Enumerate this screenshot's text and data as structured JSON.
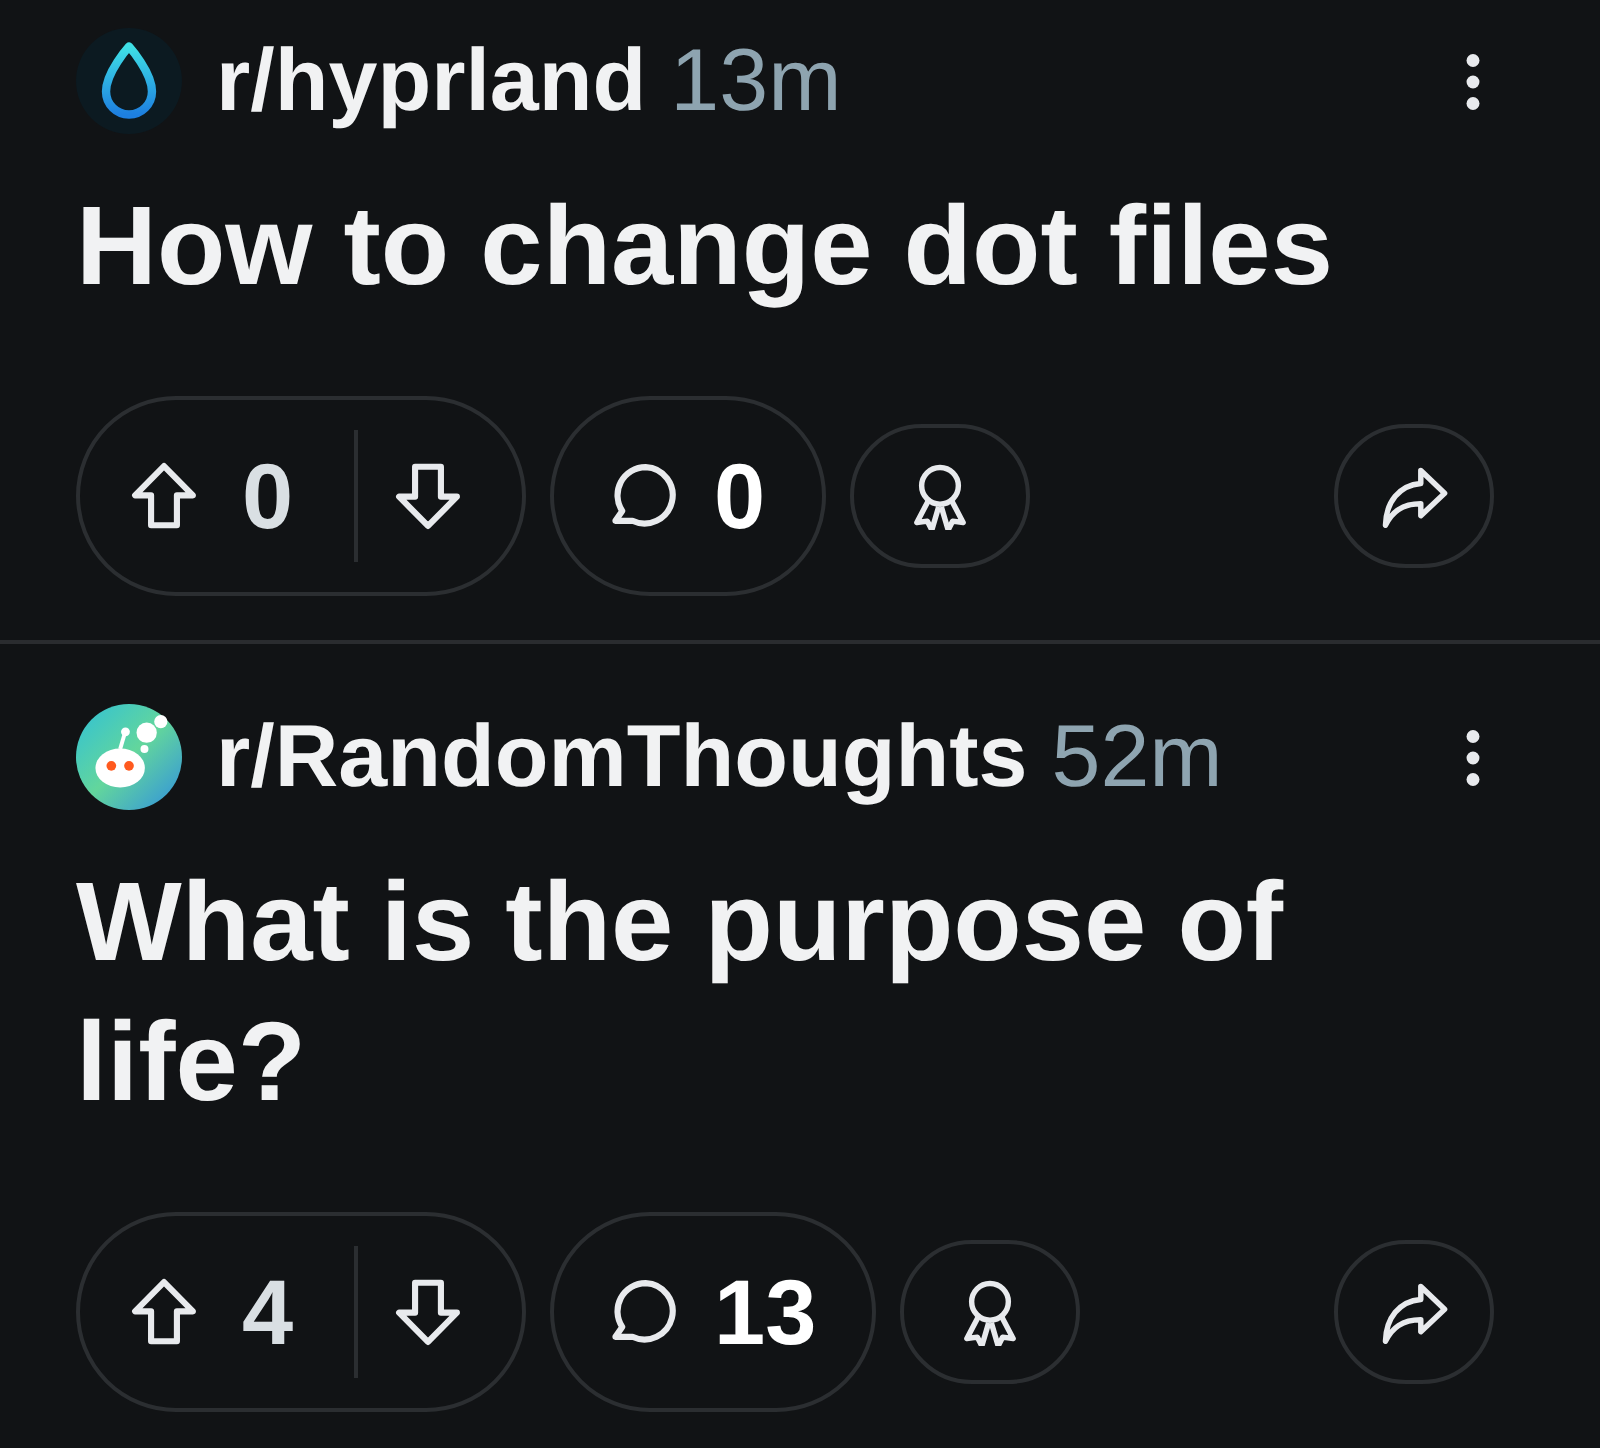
{
  "posts": [
    {
      "kind": "drop",
      "subreddit": "r/hyprland",
      "time": "13m",
      "title": "How to change dot files",
      "votes": "0",
      "comments": "0"
    },
    {
      "kind": "mascot",
      "subreddit": "r/RandomThoughts",
      "time": "52m",
      "title": "What is the purpose of life?",
      "votes": "4",
      "comments": "13"
    }
  ]
}
